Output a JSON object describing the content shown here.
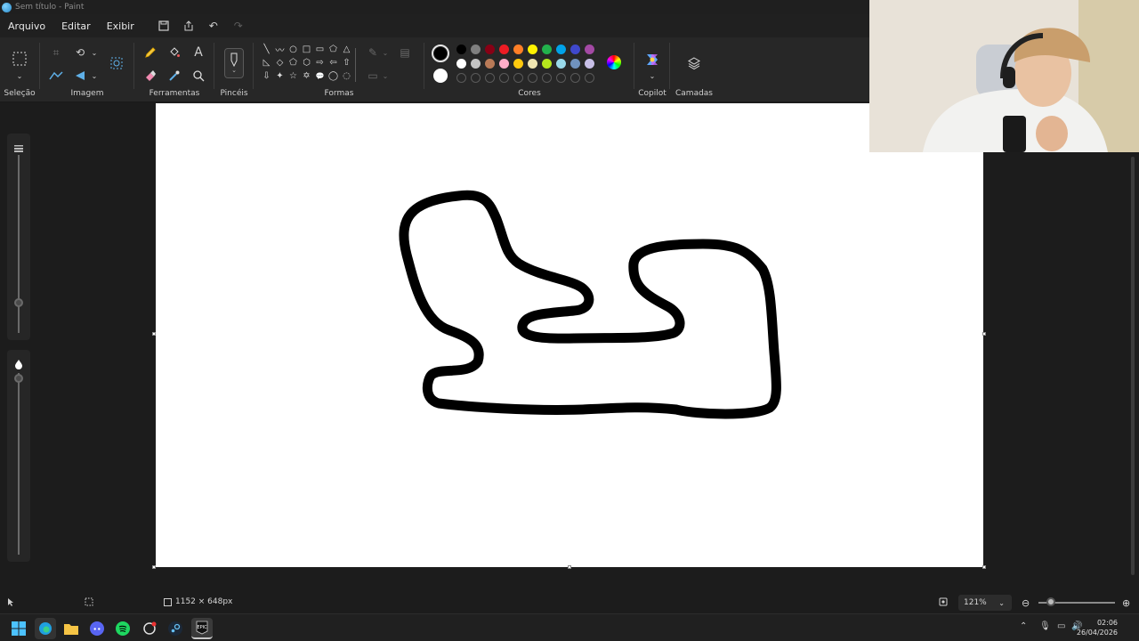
{
  "window": {
    "title": "Sem título - Paint"
  },
  "menu": {
    "items": [
      "Arquivo",
      "Editar",
      "Exibir"
    ],
    "icons": [
      "save-icon",
      "share-icon",
      "undo-icon",
      "redo-icon"
    ]
  },
  "ribbon": {
    "groups": {
      "selection": "Seleção",
      "image": "Imagem",
      "tools": "Ferramentas",
      "brushes": "Pincéis",
      "shapes": "Formas",
      "colors": "Cores",
      "copilot": "Copilot",
      "layers": "Camadas"
    },
    "shape_glyphs": [
      "╲",
      "〰",
      "○",
      "□",
      "▭",
      "⬠",
      "△",
      "◺",
      "◇",
      "⬠",
      "⬡",
      "⇨",
      "⇦",
      "⇧",
      "⇩",
      "✦",
      "☆",
      "✡",
      "💬",
      "◯",
      "◌"
    ],
    "palette_row1": [
      "#000000",
      "#7f7f7f",
      "#880015",
      "#ed1c24",
      "#ff7f27",
      "#fff200",
      "#22b14c",
      "#00a2e8",
      "#3f48cc",
      "#a349a4"
    ],
    "palette_row2": [
      "#ffffff",
      "#c3c3c3",
      "#b97a57",
      "#ffaec9",
      "#ffc90e",
      "#efe4b0",
      "#b5e61d",
      "#99d9ea",
      "#7092be",
      "#c8bfe7"
    ],
    "primary_color": "#000000",
    "secondary_color": "#ffffff"
  },
  "status": {
    "canvas_size": "1152 × 648px",
    "zoom": "121%"
  },
  "taskbar": {
    "apps": [
      "windows-start",
      "edge",
      "file-explorer",
      "discord",
      "spotify",
      "chatgpt",
      "steam",
      "epic-games"
    ],
    "time": "02:06",
    "date": "26/04/2026"
  }
}
